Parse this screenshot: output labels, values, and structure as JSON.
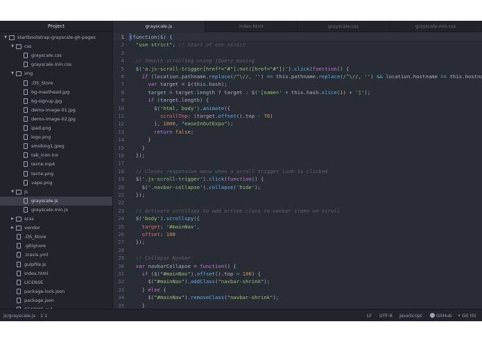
{
  "sidebar": {
    "header": "Project",
    "tree": [
      {
        "label": "startbootstrap-grayscale-gh-pages",
        "kind": "folder",
        "depth": 0,
        "open": true
      },
      {
        "label": "css",
        "kind": "folder",
        "depth": 1,
        "open": true
      },
      {
        "label": "grayscale.css",
        "kind": "file",
        "depth": 2
      },
      {
        "label": "grayscale.min.css",
        "kind": "file",
        "depth": 2
      },
      {
        "label": "img",
        "kind": "folder",
        "depth": 1,
        "open": true
      },
      {
        "label": ".DS_Store",
        "kind": "file",
        "depth": 2
      },
      {
        "label": "bg-masthead.jpg",
        "kind": "file",
        "depth": 2
      },
      {
        "label": "bg-signup.jpg",
        "kind": "file",
        "depth": 2
      },
      {
        "label": "demo-image-01.jpg",
        "kind": "file",
        "depth": 2
      },
      {
        "label": "demo-image-02.jpg",
        "kind": "file",
        "depth": 2
      },
      {
        "label": "ipad.png",
        "kind": "file",
        "depth": 2
      },
      {
        "label": "logo.png",
        "kind": "file",
        "depth": 2
      },
      {
        "label": "smoking1.jpeg",
        "kind": "file",
        "depth": 2
      },
      {
        "label": "tab_icon.ico",
        "kind": "file",
        "depth": 2
      },
      {
        "label": "terrie.mp4",
        "kind": "file",
        "depth": 2
      },
      {
        "label": "terrie.png",
        "kind": "file",
        "depth": 2
      },
      {
        "label": "vape.png",
        "kind": "file",
        "depth": 2
      },
      {
        "label": "js",
        "kind": "folder",
        "depth": 1,
        "open": true
      },
      {
        "label": "grayscale.js",
        "kind": "file",
        "depth": 2,
        "selected": true
      },
      {
        "label": "grayscale.min.js",
        "kind": "file",
        "depth": 2
      },
      {
        "label": "scss",
        "kind": "folder",
        "depth": 1,
        "open": false
      },
      {
        "label": "vendor",
        "kind": "folder",
        "depth": 1,
        "open": false
      },
      {
        "label": ".DS_Store",
        "kind": "file",
        "depth": 1
      },
      {
        "label": ".gitignore",
        "kind": "file",
        "depth": 1
      },
      {
        "label": ".travis.yml",
        "kind": "file",
        "depth": 1
      },
      {
        "label": "gulpfile.js",
        "kind": "file",
        "depth": 1
      },
      {
        "label": "index.html",
        "kind": "file",
        "depth": 1
      },
      {
        "label": "LICENSE",
        "kind": "file",
        "depth": 1
      },
      {
        "label": "package-lock.json",
        "kind": "file",
        "depth": 1
      },
      {
        "label": "package.json",
        "kind": "file",
        "depth": 1
      },
      {
        "label": "README.md",
        "kind": "file",
        "depth": 1
      }
    ]
  },
  "tabs": [
    {
      "label": "grayscale.js",
      "active": true
    },
    {
      "label": "index.html",
      "active": false
    },
    {
      "label": "grayscale.css",
      "active": false
    },
    {
      "label": "grayscale.min.css",
      "active": false
    }
  ],
  "editor": {
    "current_line": 1,
    "lines": [
      [
        [
          "pl",
          "(function($) {"
        ]
      ],
      [
        [
          "pl",
          "  "
        ],
        [
          "str",
          "\"use strict\""
        ],
        [
          "pl",
          "; "
        ],
        [
          "com",
          "// Start of use strict"
        ]
      ],
      [],
      [
        [
          "com",
          "  // Smooth scrolling using jQuery easing"
        ]
      ],
      [
        [
          "pl",
          "  $("
        ],
        [
          "str",
          "'a.js-scroll-trigger[href*=\"#\"]:not([href=\"#\"])'"
        ],
        [
          "pl",
          ")."
        ],
        [
          "fn",
          "click"
        ],
        [
          "pl",
          "("
        ],
        [
          "kw",
          "function"
        ],
        [
          "pl",
          "() {"
        ]
      ],
      [
        [
          "pl",
          "    "
        ],
        [
          "kw",
          "if"
        ],
        [
          "pl",
          " (location.pathname."
        ],
        [
          "fn",
          "replace"
        ],
        [
          "pl",
          "("
        ],
        [
          "str",
          "/^\\//"
        ],
        [
          "pl",
          ", "
        ],
        [
          "str",
          "''"
        ],
        [
          "pl",
          ") "
        ],
        [
          "op",
          "=="
        ],
        [
          "pl",
          " this.pathname."
        ],
        [
          "fn",
          "replace"
        ],
        [
          "pl",
          "("
        ],
        [
          "str",
          "/^\\//"
        ],
        [
          "pl",
          ", "
        ],
        [
          "str",
          "''"
        ],
        [
          "pl",
          ") "
        ],
        [
          "op",
          "&&"
        ],
        [
          "pl",
          " location.hostname "
        ],
        [
          "op",
          "=="
        ],
        [
          "pl",
          " this.hostname) {"
        ]
      ],
      [
        [
          "pl",
          "      "
        ],
        [
          "kw",
          "var"
        ],
        [
          "pl",
          " target = $(this.hash);"
        ]
      ],
      [
        [
          "pl",
          "      target = target.length ? target : $("
        ],
        [
          "str",
          "'[name='"
        ],
        [
          "pl",
          " + this.hash."
        ],
        [
          "fn",
          "slice"
        ],
        [
          "pl",
          "("
        ],
        [
          "num",
          "1"
        ],
        [
          "pl",
          ") + "
        ],
        [
          "str",
          "']'"
        ],
        [
          "pl",
          ");"
        ]
      ],
      [
        [
          "pl",
          "      "
        ],
        [
          "kw",
          "if"
        ],
        [
          "pl",
          " (target.length) {"
        ]
      ],
      [
        [
          "pl",
          "        $("
        ],
        [
          "str",
          "'html, body'"
        ],
        [
          "pl",
          ")."
        ],
        [
          "fn",
          "animate"
        ],
        [
          "pl",
          "({"
        ]
      ],
      [
        [
          "pl",
          "          "
        ],
        [
          "prop",
          "scrollTop"
        ],
        [
          "pl",
          ": (target."
        ],
        [
          "fn",
          "offset"
        ],
        [
          "pl",
          "().top - "
        ],
        [
          "num",
          "70"
        ],
        [
          "pl",
          ")"
        ]
      ],
      [
        [
          "pl",
          "        }, "
        ],
        [
          "num",
          "1000"
        ],
        [
          "pl",
          ", "
        ],
        [
          "str",
          "\"easeInOutExpo\""
        ],
        [
          "pl",
          ");"
        ]
      ],
      [
        [
          "pl",
          "        "
        ],
        [
          "kw",
          "return"
        ],
        [
          "pl",
          " "
        ],
        [
          "num",
          "false"
        ],
        [
          "pl",
          ";"
        ]
      ],
      [
        [
          "pl",
          "      }"
        ]
      ],
      [
        [
          "pl",
          "    }"
        ]
      ],
      [
        [
          "pl",
          "  });"
        ]
      ],
      [],
      [
        [
          "com",
          "  // Closes responsive menu when a scroll trigger link is clicked"
        ]
      ],
      [
        [
          "pl",
          "  $("
        ],
        [
          "str",
          "'.js-scroll-trigger'"
        ],
        [
          "pl",
          ")."
        ],
        [
          "fn",
          "click"
        ],
        [
          "pl",
          "("
        ],
        [
          "kw",
          "function"
        ],
        [
          "pl",
          "() {"
        ]
      ],
      [
        [
          "pl",
          "    $("
        ],
        [
          "str",
          "'.navbar-collapse'"
        ],
        [
          "pl",
          ")."
        ],
        [
          "fn",
          "collapse"
        ],
        [
          "pl",
          "("
        ],
        [
          "str",
          "'hide'"
        ],
        [
          "pl",
          ");"
        ]
      ],
      [
        [
          "pl",
          "  });"
        ]
      ],
      [],
      [
        [
          "com",
          "  // Activate scrollspy to add active class to navbar items on scroll"
        ]
      ],
      [
        [
          "pl",
          "  $("
        ],
        [
          "str",
          "'body'"
        ],
        [
          "pl",
          ")."
        ],
        [
          "fn",
          "scrollspy"
        ],
        [
          "pl",
          "({"
        ]
      ],
      [
        [
          "pl",
          "    "
        ],
        [
          "prop",
          "target"
        ],
        [
          "pl",
          ": "
        ],
        [
          "str",
          "'#mainNav'"
        ],
        [
          "pl",
          ","
        ]
      ],
      [
        [
          "pl",
          "    "
        ],
        [
          "prop",
          "offset"
        ],
        [
          "pl",
          ": "
        ],
        [
          "num",
          "100"
        ]
      ],
      [
        [
          "pl",
          "  });"
        ]
      ],
      [],
      [
        [
          "com",
          "  // Collapse Navbar"
        ]
      ],
      [
        [
          "pl",
          "  "
        ],
        [
          "kw",
          "var"
        ],
        [
          "pl",
          " navbarCollapse = "
        ],
        [
          "kw",
          "function"
        ],
        [
          "pl",
          "() {"
        ]
      ],
      [
        [
          "pl",
          "    "
        ],
        [
          "kw",
          "if"
        ],
        [
          "pl",
          " ($("
        ],
        [
          "str",
          "\"#mainNav\""
        ],
        [
          "pl",
          ")."
        ],
        [
          "fn",
          "offset"
        ],
        [
          "pl",
          "().top "
        ],
        [
          "op",
          ">"
        ],
        [
          "pl",
          " "
        ],
        [
          "num",
          "100"
        ],
        [
          "pl",
          ") {"
        ]
      ],
      [
        [
          "pl",
          "      $("
        ],
        [
          "str",
          "\"#mainNav\""
        ],
        [
          "pl",
          ")."
        ],
        [
          "fn",
          "addClass"
        ],
        [
          "pl",
          "("
        ],
        [
          "str",
          "\"navbar-shrink\""
        ],
        [
          "pl",
          ");"
        ]
      ],
      [
        [
          "pl",
          "    } "
        ],
        [
          "kw",
          "else"
        ],
        [
          "pl",
          " {"
        ]
      ],
      [
        [
          "pl",
          "      $("
        ],
        [
          "str",
          "\"#mainNav\""
        ],
        [
          "pl",
          ")."
        ],
        [
          "fn",
          "removeClass"
        ],
        [
          "pl",
          "("
        ],
        [
          "str",
          "\"navbar-shrink\""
        ],
        [
          "pl",
          ");"
        ]
      ],
      [
        [
          "pl",
          "    }"
        ]
      ]
    ]
  },
  "status": {
    "path": "js/grayscale.js",
    "cursor": "1:1",
    "line_ending": "LF",
    "encoding": "UTF-8",
    "grammar": "JavaScript",
    "github": "GitHub",
    "git": "Git (0)"
  },
  "colors": {
    "editor_bg": "#282c34",
    "sidebar_bg": "#21252b",
    "comment": "#5c6370",
    "string": "#98c379",
    "keyword": "#c678dd",
    "function": "#61afef",
    "number": "#d19a66"
  }
}
